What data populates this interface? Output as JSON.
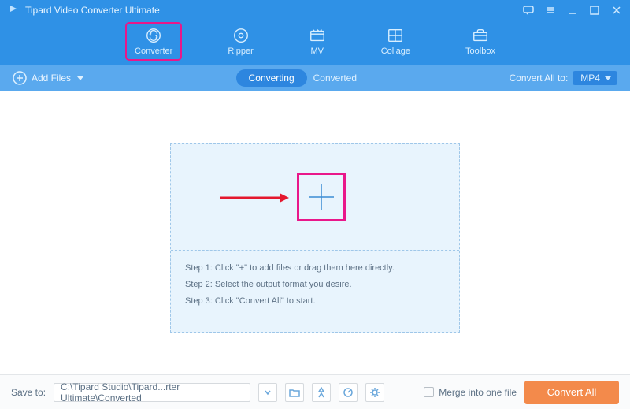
{
  "app_title": "Tipard Video Converter Ultimate",
  "tabs": {
    "converter": "Converter",
    "ripper": "Ripper",
    "mv": "MV",
    "collage": "Collage",
    "toolbox": "Toolbox"
  },
  "subbar": {
    "add_files": "Add Files",
    "converting": "Converting",
    "converted": "Converted",
    "convert_all_to": "Convert All to:",
    "format_selected": "MP4"
  },
  "steps": {
    "step1": "Step 1: Click \"+\" to add files or drag them here directly.",
    "step2": "Step 2: Select the output format you desire.",
    "step3": "Step 3: Click \"Convert All\" to start."
  },
  "bottom": {
    "save_to": "Save to:",
    "save_path": "C:\\Tipard Studio\\Tipard...rter Ultimate\\Converted",
    "merge": "Merge into one file",
    "convert_all": "Convert All"
  }
}
